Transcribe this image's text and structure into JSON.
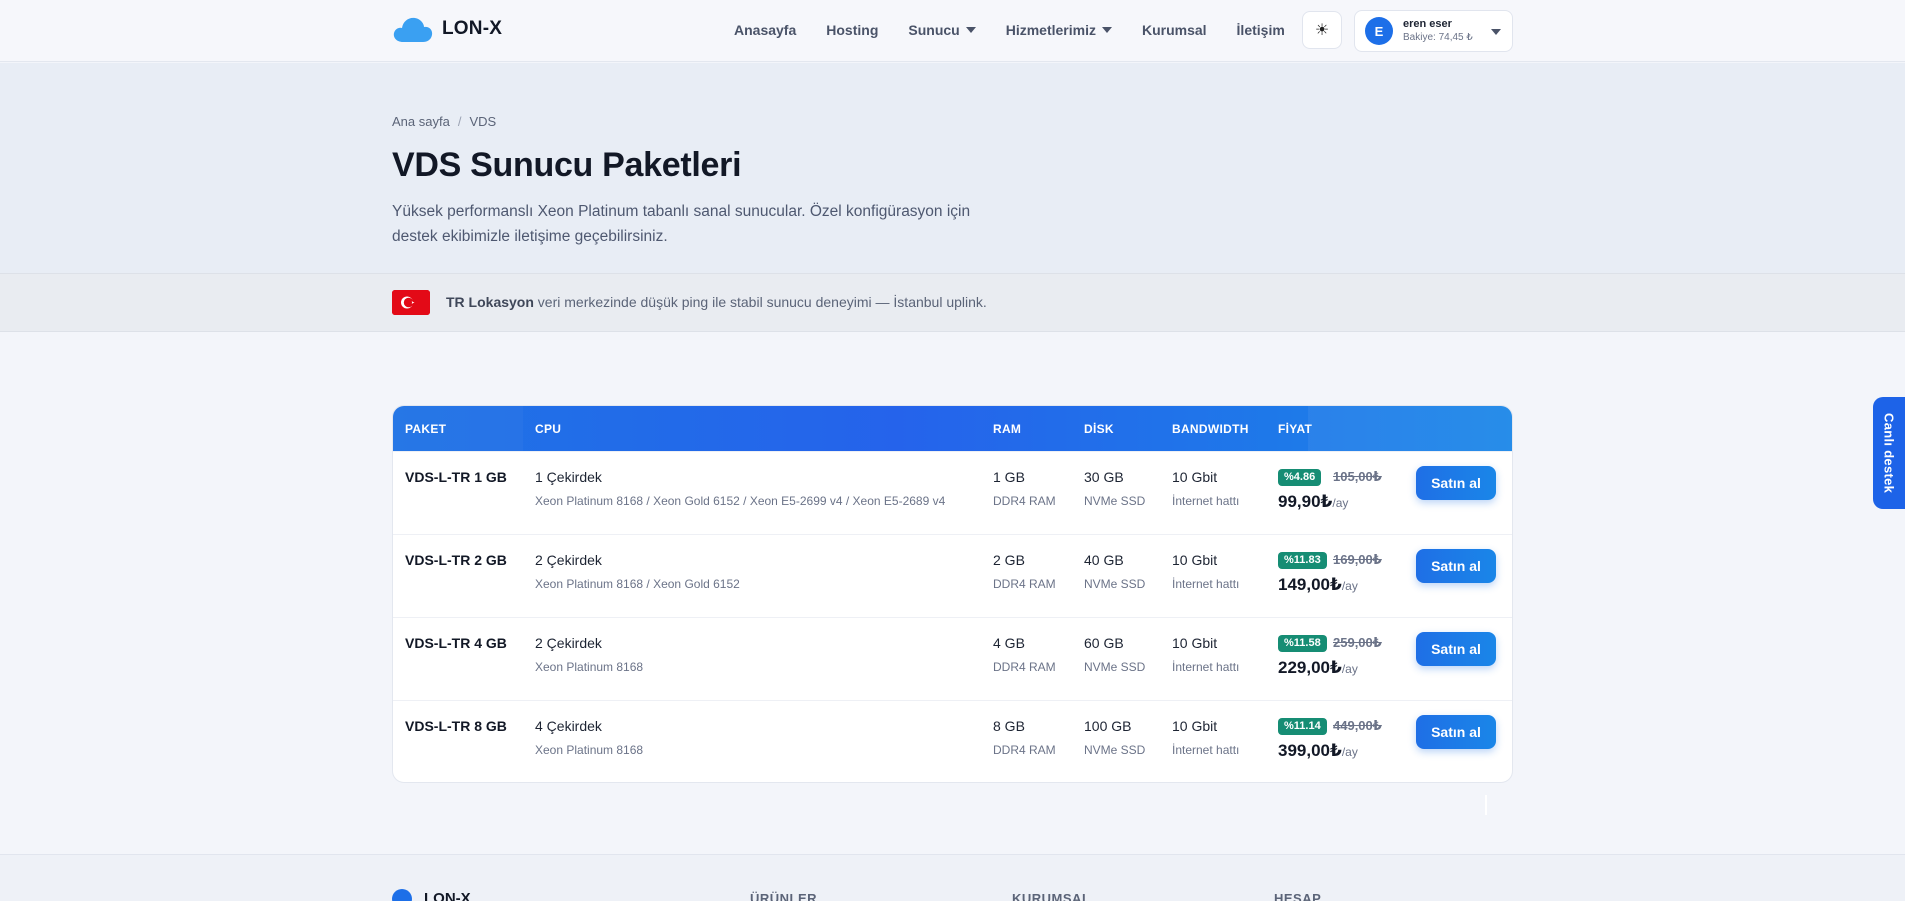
{
  "brand": {
    "name": "LON-X"
  },
  "nav": {
    "items": [
      {
        "label": "Anasayfa",
        "dropdown": false
      },
      {
        "label": "Hosting",
        "dropdown": false
      },
      {
        "label": "Sunucu",
        "dropdown": true
      },
      {
        "label": "Hizmetlerimiz",
        "dropdown": true
      },
      {
        "label": "Kurumsal",
        "dropdown": false
      },
      {
        "label": "İletişim",
        "dropdown": false
      }
    ],
    "theme_icon": "☀"
  },
  "user": {
    "initial": "E",
    "name": "eren eser",
    "balance": "Bakiye: 74,45 ₺"
  },
  "breadcrumb": {
    "home": "Ana sayfa",
    "separator": "/",
    "current": "VDS"
  },
  "hero": {
    "title": "VDS Sunucu Paketleri",
    "description": "Yüksek performanslı Xeon Platinum tabanlı sanal sunucular. Özel konfigürasyon için destek ekibimizle iletişime geçebilirsiniz."
  },
  "location": {
    "strong": "TR Lokasyon",
    "text": " veri merkezinde düşük ping ile stabil sunucu deneyimi — İstanbul uplink."
  },
  "table": {
    "headers": {
      "paket": "PAKET",
      "cpu": "CPU",
      "ram": "RAM",
      "disk": "DİSK",
      "bandwidth": "BANDWIDTH",
      "fiyat": "FİYAT"
    },
    "rows": [
      {
        "name": "VDS-L-TR 1 GB",
        "cores": "1 Çekirdek",
        "cpu": "Xeon Platinum 8168 / Xeon Gold 6152 / Xeon E5-2699 v4 / Xeon E5-2689 v4",
        "ram": "1 GB",
        "ram_type": "DDR4 RAM",
        "disk": "30 GB",
        "disk_type": "NVMe SSD",
        "bw": "10 Gbit",
        "bw_type": "İnternet hattı",
        "discount": "%4.86",
        "old_price": "105,00₺",
        "price": "99,90₺",
        "per": "/ay",
        "buy": "Satın al"
      },
      {
        "name": "VDS-L-TR 2 GB",
        "cores": "2 Çekirdek",
        "cpu": "Xeon Platinum 8168 / Xeon Gold 6152",
        "ram": "2 GB",
        "ram_type": "DDR4 RAM",
        "disk": "40 GB",
        "disk_type": "NVMe SSD",
        "bw": "10 Gbit",
        "bw_type": "İnternet hattı",
        "discount": "%11.83",
        "old_price": "169,00₺",
        "price": "149,00₺",
        "per": "/ay",
        "buy": "Satın al"
      },
      {
        "name": "VDS-L-TR 4 GB",
        "cores": "2 Çekirdek",
        "cpu": "Xeon Platinum 8168",
        "ram": "4 GB",
        "ram_type": "DDR4 RAM",
        "disk": "60 GB",
        "disk_type": "NVMe SSD",
        "bw": "10 Gbit",
        "bw_type": "İnternet hattı",
        "discount": "%11.58",
        "old_price": "259,00₺",
        "price": "229,00₺",
        "per": "/ay",
        "buy": "Satın al"
      },
      {
        "name": "VDS-L-TR 8 GB",
        "cores": "4 Çekirdek",
        "cpu": "Xeon Platinum 8168",
        "ram": "8 GB",
        "ram_type": "DDR4 RAM",
        "disk": "100 GB",
        "disk_type": "NVMe SSD",
        "bw": "10 Gbit",
        "bw_type": "İnternet hattı",
        "discount": "%11.14",
        "old_price": "449,00₺",
        "price": "399,00₺",
        "per": "/ay",
        "buy": "Satın al"
      }
    ]
  },
  "live_support": "Canlı destek",
  "footer": {
    "brand": "LON-X",
    "columns": [
      "ÜRÜNLER",
      "KURUMSAL",
      "HESAP"
    ]
  },
  "colors": {
    "accent": "#1d6fe8",
    "badge": "#168d74",
    "flag": "#e30a17"
  }
}
